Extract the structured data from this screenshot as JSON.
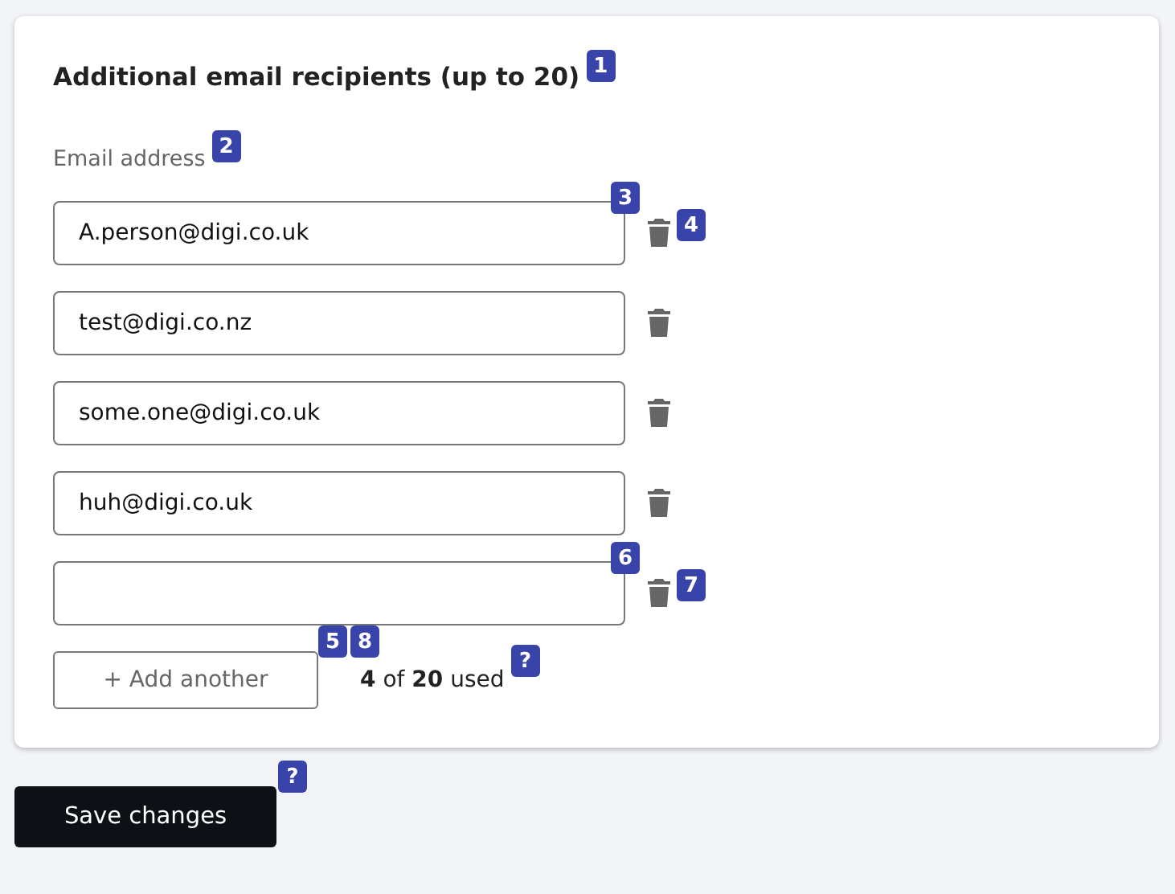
{
  "card": {
    "title": "Additional email recipients (up to 20)",
    "title_badge": "1",
    "field_label": "Email address",
    "field_label_badge": "2",
    "recipients": [
      {
        "value": "A.person@digi.co.uk",
        "field_badge": "3",
        "delete_badge": "4"
      },
      {
        "value": "test@digi.co.nz"
      },
      {
        "value": "some.one@digi.co.uk"
      },
      {
        "value": "huh@digi.co.uk"
      },
      {
        "field_badge": "6",
        "delete_badge": "7"
      }
    ],
    "add_button": {
      "label": "+ Add another",
      "badges": [
        "5",
        "8"
      ]
    },
    "usage": {
      "text": "**4** of **20** used",
      "badge": "?"
    }
  },
  "save_button": {
    "label": "Save changes",
    "badge": "?"
  }
}
